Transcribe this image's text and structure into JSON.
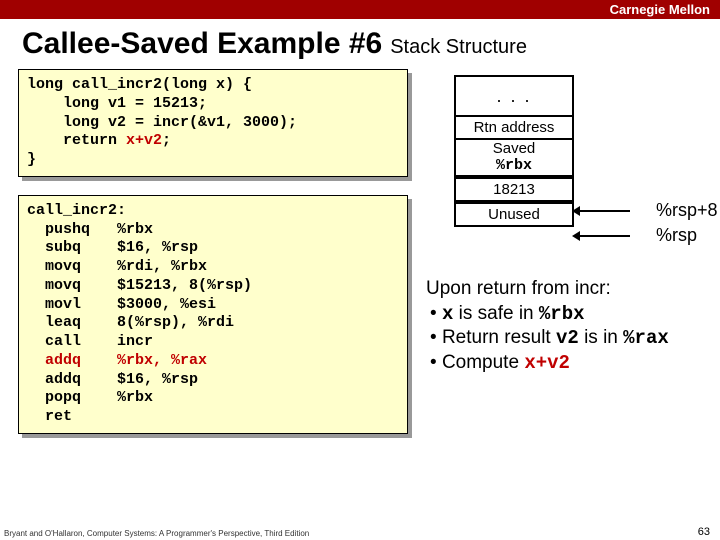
{
  "header": {
    "brand": "Carnegie Mellon"
  },
  "title": "Callee-Saved Example #6",
  "subtitle": "Stack Structure",
  "c_code": {
    "l1": "long call_incr2(long x) {",
    "l2": "    long v1 = 15213;",
    "l3": "    long v2 = incr(&v1, 3000);",
    "l4a": "    return ",
    "l4b": "x+v2",
    "l4c": ";",
    "l5": "}"
  },
  "asm": {
    "l1": "call_incr2:",
    "l2": "  pushq   %rbx",
    "l3": "  subq    $16, %rsp",
    "l4": "  movq    %rdi, %rbx",
    "l5": "  movq    $15213, 8(%rsp)",
    "l6": "  movl    $3000, %esi",
    "l7": "  leaq    8(%rsp), %rdi",
    "l8": "  call    incr",
    "l9a": "  addq    %rbx, ",
    "l9b": "%rax",
    "l10": "  addq    $16, %rsp",
    "l11": "  popq    %rbx",
    "l12": "  ret"
  },
  "stack": {
    "dots": ". . .",
    "rtn": "Rtn address",
    "saved1": "Saved",
    "saved2": "%rbx",
    "v1": "18213",
    "unused": "Unused",
    "ptr1": "%rsp+8",
    "ptr2": "%rsp"
  },
  "notes": {
    "heading": "Upon return from incr:",
    "b1a": "x",
    "b1b": " is safe in ",
    "b1c": "%rbx",
    "b2a": "Return result ",
    "b2b": "v2",
    "b2c": " is in ",
    "b2d": "%rax",
    "b3a": "Compute  ",
    "b3b": "x+v2"
  },
  "footer": "Bryant and O'Hallaron, Computer Systems: A Programmer's Perspective, Third Edition",
  "pagenum": "63"
}
